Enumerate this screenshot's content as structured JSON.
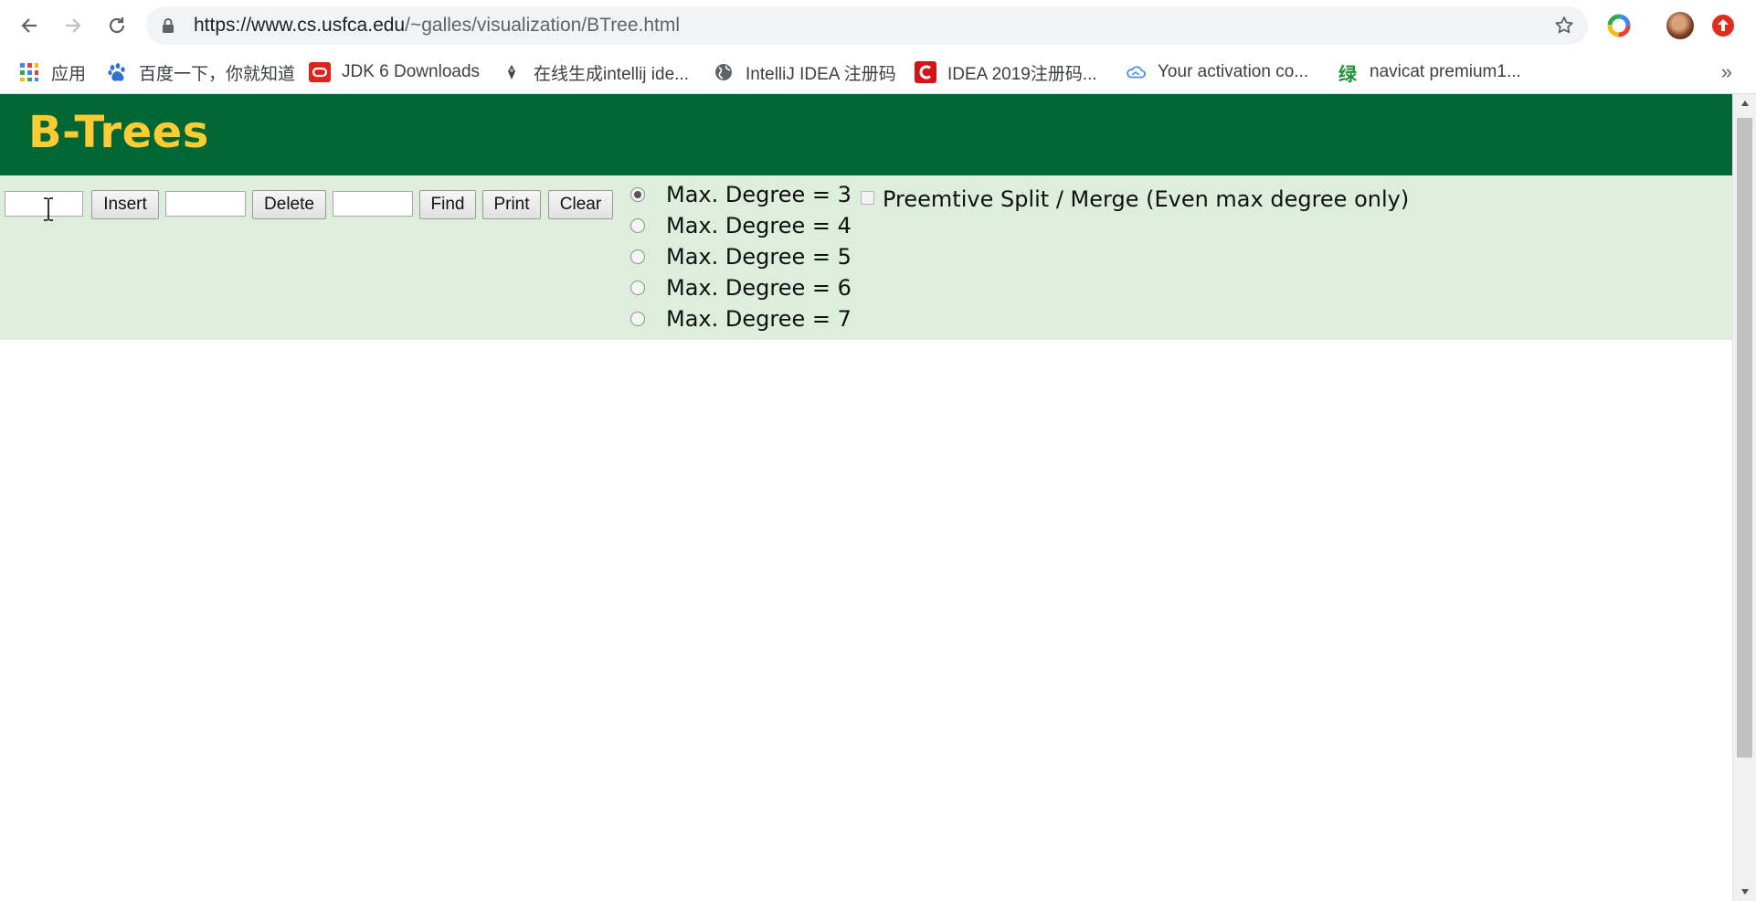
{
  "browser": {
    "url_host": "https://www.cs.usfca.edu",
    "url_path": "/~galles/visualization/BTree.html",
    "bookmarks": [
      {
        "label": "应用",
        "icon": "apps-grid-icon"
      },
      {
        "label": "百度一下，你就知道",
        "icon": "baidu-paw-icon"
      },
      {
        "label": "JDK 6 Downloads",
        "icon": "oracle-icon"
      },
      {
        "label": "在线生成intellij ide...",
        "icon": "bookmark-site-icon"
      },
      {
        "label": "IntelliJ IDEA 注册码",
        "icon": "globe-icon"
      },
      {
        "label": "IDEA 2019注册码...",
        "icon": "red-c-icon"
      },
      {
        "label": "Your activation co...",
        "icon": "cloud-icon"
      },
      {
        "label": "navicat premium1...",
        "icon": "green-character-icon"
      }
    ],
    "bookmarks_more": "»"
  },
  "page": {
    "title": "B-Trees",
    "insert_label": "Insert",
    "delete_label": "Delete",
    "find_label": "Find",
    "print_label": "Print",
    "clear_label": "Clear",
    "insert_value": "",
    "delete_value": "",
    "find_value": "",
    "degree_options": [
      {
        "label": "Max. Degree = 3",
        "checked": true
      },
      {
        "label": "Max. Degree = 4",
        "checked": false
      },
      {
        "label": "Max. Degree = 5",
        "checked": false
      },
      {
        "label": "Max. Degree = 6",
        "checked": false
      },
      {
        "label": "Max. Degree = 7",
        "checked": false
      }
    ],
    "preemptive_label": "Preemtive Split / Merge (Even max degree only)",
    "preemptive_checked": false
  },
  "colors": {
    "header_bg": "#006633",
    "title_color": "#ffcc33",
    "controls_bg": "#ddeedd"
  }
}
